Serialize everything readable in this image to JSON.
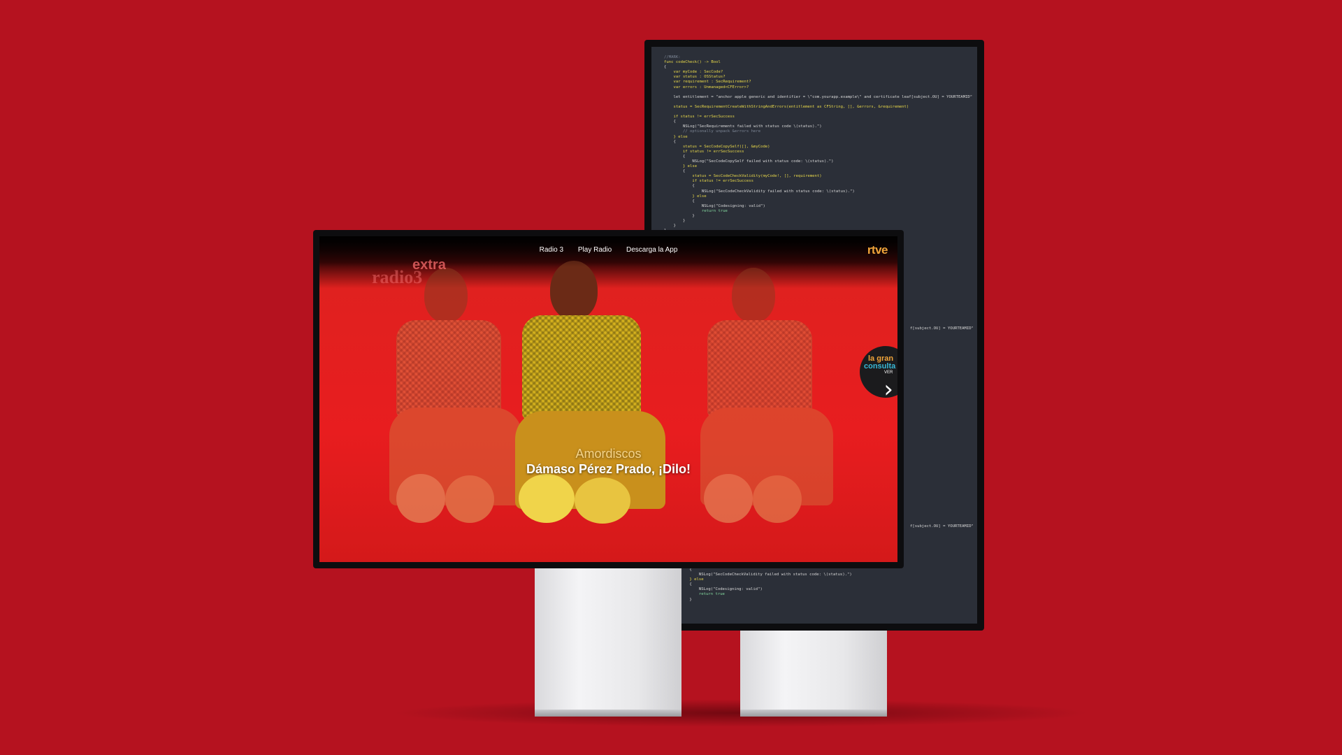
{
  "code_editor": {
    "lines": [
      {
        "text": "//MARK:",
        "cls": "com"
      },
      {
        "text": "func codeCheck() -> Bool",
        "cls": "key"
      },
      {
        "text": "{",
        "cls": ""
      },
      {
        "text": "    var myCode : SecCode?",
        "cls": "key"
      },
      {
        "text": "    var status : OSStatus?",
        "cls": "key"
      },
      {
        "text": "    var requirement : SecRequirement?",
        "cls": "key"
      },
      {
        "text": "    var errors : Unmanaged<CFError>?",
        "cls": "key"
      },
      {
        "text": "",
        "cls": ""
      },
      {
        "text": "    let entitlement = \"anchor apple generic and identifier = \\\"com.yourapp.example\\\" and certificate leaf[subject.OU] = YOURTEAMID\"",
        "cls": ""
      },
      {
        "text": "",
        "cls": ""
      },
      {
        "text": "    status = SecRequirementCreateWithStringAndErrors(entitlement as CFString, [], &errors, &requirement)",
        "cls": "key"
      },
      {
        "text": "",
        "cls": ""
      },
      {
        "text": "    if status != errSecSuccess",
        "cls": "key"
      },
      {
        "text": "    {",
        "cls": ""
      },
      {
        "text": "        NSLog(\"SecRequirements failed with status code \\(status).\")",
        "cls": ""
      },
      {
        "text": "        // optionally unpack &errors here",
        "cls": "com"
      },
      {
        "text": "    } else",
        "cls": "key"
      },
      {
        "text": "    {",
        "cls": ""
      },
      {
        "text": "        status = SecCodeCopySelf([], &myCode)",
        "cls": "key"
      },
      {
        "text": "        if status != errSecSuccess",
        "cls": "key"
      },
      {
        "text": "        {",
        "cls": ""
      },
      {
        "text": "            NSLog(\"SecCodeCopySelf failed with status code: \\(status).\")",
        "cls": ""
      },
      {
        "text": "        } else",
        "cls": "key"
      },
      {
        "text": "        {",
        "cls": ""
      },
      {
        "text": "            status = SecCodeCheckValidity(myCode!, [], requirement)",
        "cls": "key"
      },
      {
        "text": "            if status != errSecSuccess",
        "cls": "key"
      },
      {
        "text": "            {",
        "cls": ""
      },
      {
        "text": "                NSLog(\"SecCodeCheckValidity failed with status code: \\(status).\")",
        "cls": ""
      },
      {
        "text": "            } else",
        "cls": "key"
      },
      {
        "text": "            {",
        "cls": ""
      },
      {
        "text": "                NSLog(\"Codesigning: valid\")",
        "cls": ""
      },
      {
        "text": "                return true",
        "cls": "grn"
      },
      {
        "text": "            }",
        "cls": ""
      },
      {
        "text": "        }",
        "cls": ""
      },
      {
        "text": "    }",
        "cls": ""
      },
      {
        "text": "}",
        "cls": ""
      }
    ],
    "side_fragment": "f[subject.OU] = YOURTEAMID\"",
    "lower_lines": [
      {
        "text": "            {",
        "cls": ""
      },
      {
        "text": "                NSLog(\"SecCodeCheckValidity failed with status code: \\(status).\")",
        "cls": ""
      },
      {
        "text": "            } else",
        "cls": "key"
      },
      {
        "text": "            {",
        "cls": ""
      },
      {
        "text": "                NSLog(\"Codesigning: valid\")",
        "cls": ""
      },
      {
        "text": "                return true",
        "cls": "grn"
      },
      {
        "text": "            }",
        "cls": ""
      }
    ]
  },
  "site": {
    "nav": [
      "Radio 3",
      "Play Radio",
      "Descarga la App"
    ],
    "logo": "rtve",
    "program_logo": {
      "small": "radio3",
      "big": "extra"
    },
    "caption_sub": "Amordiscos",
    "caption_title": "Dámaso Pérez Prado, ¡Dilo!",
    "badge": {
      "line1": "la gran",
      "line2": "consulta",
      "line3": "VER"
    },
    "next_arrow": "›"
  },
  "colors": {
    "background": "#b5121f",
    "screen_red": "#e81d1f",
    "logo_orange": "#f0a43a",
    "badge_blue": "#38b8d6"
  }
}
